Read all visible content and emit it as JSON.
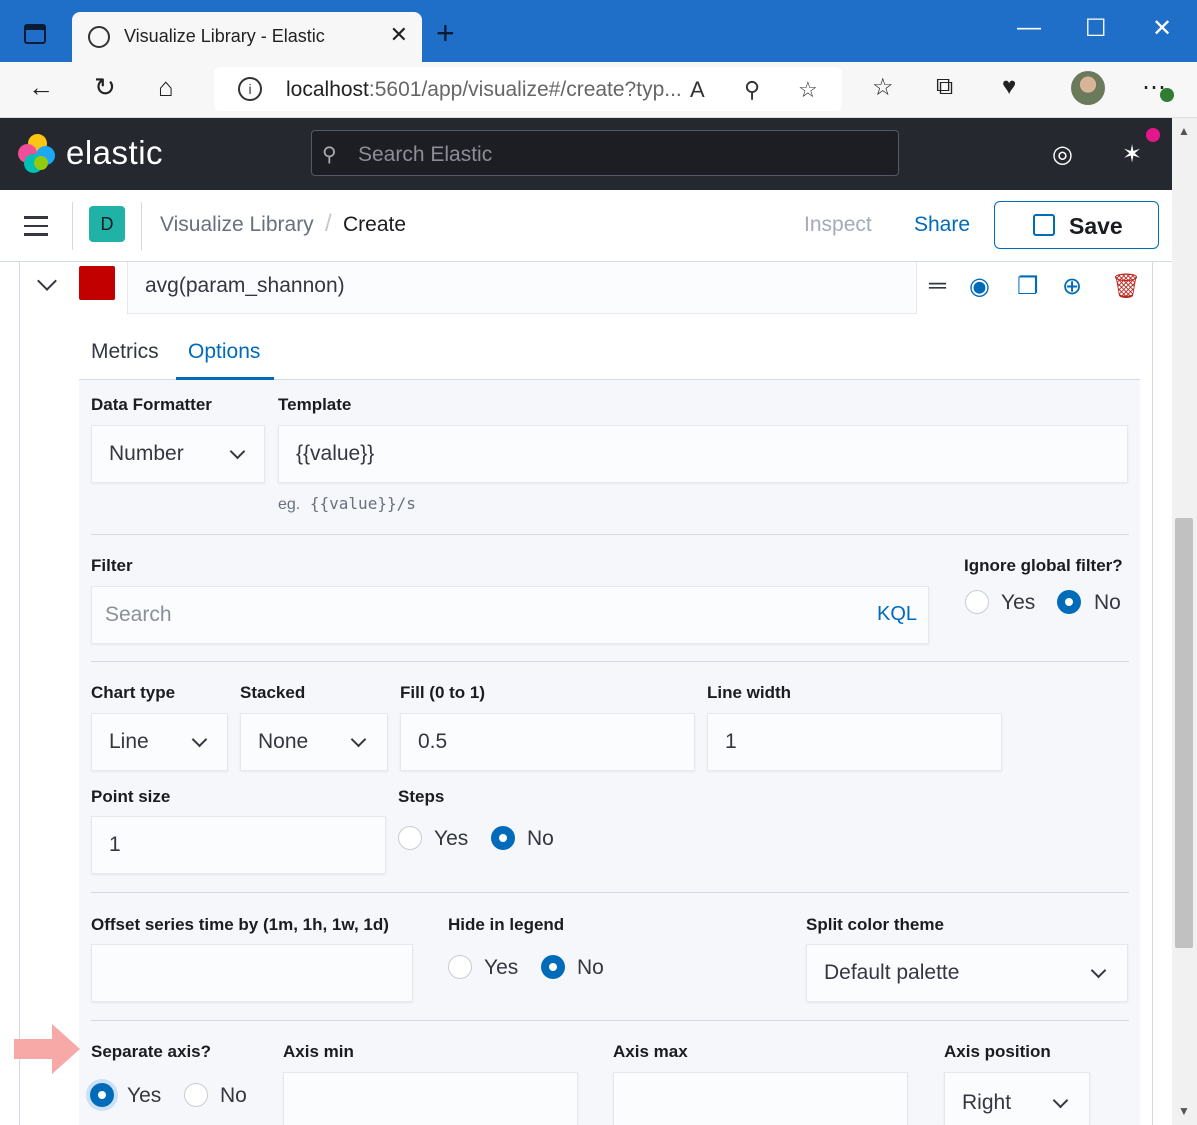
{
  "browser": {
    "tab_title": "Visualize Library - Elastic",
    "url_host": "localhost",
    "url_rest": ":5601/app/visualize#/create?typ...",
    "new_tab": "+",
    "close": "✕"
  },
  "header": {
    "logo_text": "elastic",
    "search_placeholder": "Search Elastic"
  },
  "breadcrumbs": {
    "space_initial": "D",
    "items": [
      "Visualize Library",
      "Create"
    ],
    "separator": "/",
    "inspect": "Inspect",
    "share": "Share",
    "save": "Save"
  },
  "series": {
    "label": "avg(param_shannon)",
    "color": "#c20000"
  },
  "tabs": [
    "Metrics",
    "Options"
  ],
  "options": {
    "data_formatter_label": "Data Formatter",
    "data_formatter_value": "Number",
    "template_label": "Template",
    "template_value": "{{value}}",
    "template_help_prefix": "eg.",
    "template_help_code": "{{value}}/s",
    "filter_label": "Filter",
    "filter_placeholder": "Search",
    "kql": "KQL",
    "ignore_global_label": "Ignore global filter?",
    "chart_type_label": "Chart type",
    "chart_type_value": "Line",
    "stacked_label": "Stacked",
    "stacked_value": "None",
    "fill_label": "Fill (0 to 1)",
    "fill_value": "0.5",
    "line_width_label": "Line width",
    "line_width_value": "1",
    "point_size_label": "Point size",
    "point_size_value": "1",
    "steps_label": "Steps",
    "offset_label": "Offset series time by (1m, 1h, 1w, 1d)",
    "hide_legend_label": "Hide in legend",
    "split_color_label": "Split color theme",
    "split_color_value": "Default palette",
    "separate_axis_label": "Separate axis?",
    "axis_min_label": "Axis min",
    "axis_max_label": "Axis max",
    "axis_position_label": "Axis position",
    "axis_position_value": "Right",
    "yes": "Yes",
    "no": "No"
  }
}
